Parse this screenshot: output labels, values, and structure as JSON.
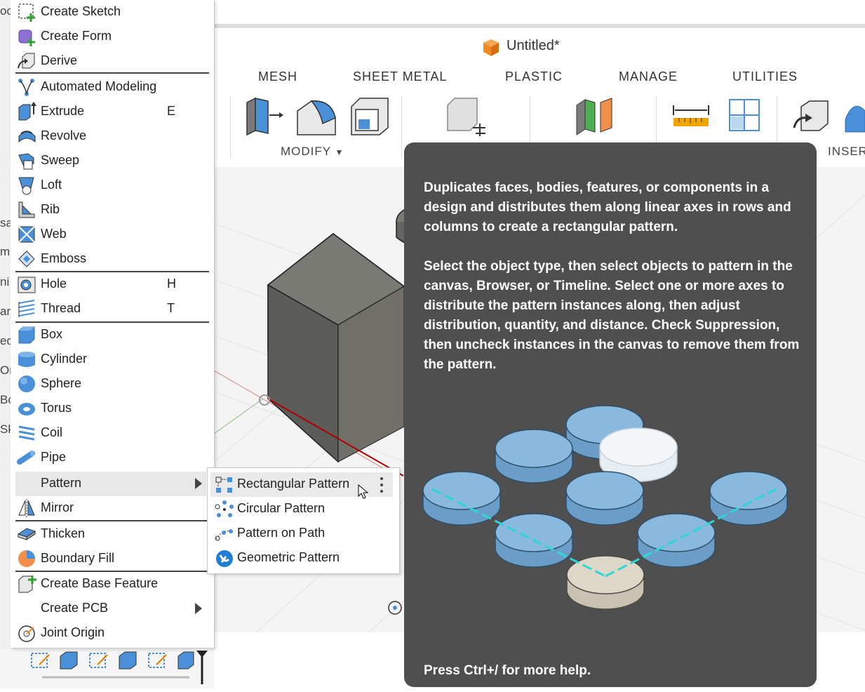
{
  "document": {
    "title": "Untitled*"
  },
  "tabs": [
    "MESH",
    "SHEET METAL",
    "PLASTIC",
    "MANAGE",
    "UTILITIES"
  ],
  "toolbar": {
    "modify_label": "MODIFY",
    "insert_label": "INSER"
  },
  "left_edge_chars": [
    "oc",
    "sa",
    "m",
    "ni",
    "ar",
    "ed",
    "Or",
    "Bo",
    "Sk"
  ],
  "menu": {
    "items": [
      {
        "label": "Create Sketch",
        "icon": "create-sketch-icon"
      },
      {
        "label": "Create Form",
        "icon": "create-form-icon"
      },
      {
        "label": "Derive",
        "icon": "derive-icon"
      },
      {
        "label": "Automated Modeling",
        "icon": "automated-modeling-icon"
      },
      {
        "label": "Extrude",
        "shortcut": "E",
        "icon": "extrude-icon"
      },
      {
        "label": "Revolve",
        "icon": "revolve-icon"
      },
      {
        "label": "Sweep",
        "icon": "sweep-icon"
      },
      {
        "label": "Loft",
        "icon": "loft-icon"
      },
      {
        "label": "Rib",
        "icon": "rib-icon"
      },
      {
        "label": "Web",
        "icon": "web-icon"
      },
      {
        "label": "Emboss",
        "icon": "emboss-icon"
      },
      {
        "label": "Hole",
        "shortcut": "H",
        "icon": "hole-icon"
      },
      {
        "label": "Thread",
        "shortcut": "T",
        "icon": "thread-icon"
      },
      {
        "label": "Box",
        "icon": "box-icon"
      },
      {
        "label": "Cylinder",
        "icon": "cylinder-icon"
      },
      {
        "label": "Sphere",
        "icon": "sphere-icon"
      },
      {
        "label": "Torus",
        "icon": "torus-icon"
      },
      {
        "label": "Coil",
        "icon": "coil-icon"
      },
      {
        "label": "Pipe",
        "icon": "pipe-icon"
      },
      {
        "label": "Pattern",
        "icon": "none",
        "submenu": true
      },
      {
        "label": "Mirror",
        "icon": "mirror-icon"
      },
      {
        "label": "Thicken",
        "icon": "thicken-icon"
      },
      {
        "label": "Boundary Fill",
        "icon": "boundary-fill-icon"
      },
      {
        "label": "Create Base Feature",
        "icon": "create-base-feature-icon"
      },
      {
        "label": "Create PCB",
        "icon": "none",
        "submenu": true
      },
      {
        "label": "Joint Origin",
        "icon": "joint-origin-icon"
      }
    ]
  },
  "submenu": {
    "items": [
      {
        "label": "Rectangular Pattern",
        "icon": "rectangular-pattern-icon"
      },
      {
        "label": "Circular Pattern",
        "icon": "circular-pattern-icon"
      },
      {
        "label": "Pattern on Path",
        "icon": "pattern-on-path-icon"
      },
      {
        "label": "Geometric Pattern",
        "icon": "geometric-pattern-icon"
      }
    ]
  },
  "tooltip": {
    "paragraph1": "Duplicates faces, bodies, features, or components in a design and distributes them along linear axes in rows and columns to create a rectangular pattern.",
    "paragraph2": "Select the object type, then select objects to pattern in the canvas, Browser, or Timeline. Select one or more axes to distribute the pattern instances along, then adjust distribution, quantity, and distance. Check Suppression, then uncheck instances in the canvas to remove them from the pattern.",
    "footer": "Press Ctrl+/ for more help."
  },
  "colors": {
    "accent_blue": "#3d8fd1",
    "tooltip_bg": "#4f4f4f",
    "disk_blue": "#7fb3dd",
    "pattern_axis": "#2fd6d6",
    "body_gray": "#6b6b66"
  }
}
